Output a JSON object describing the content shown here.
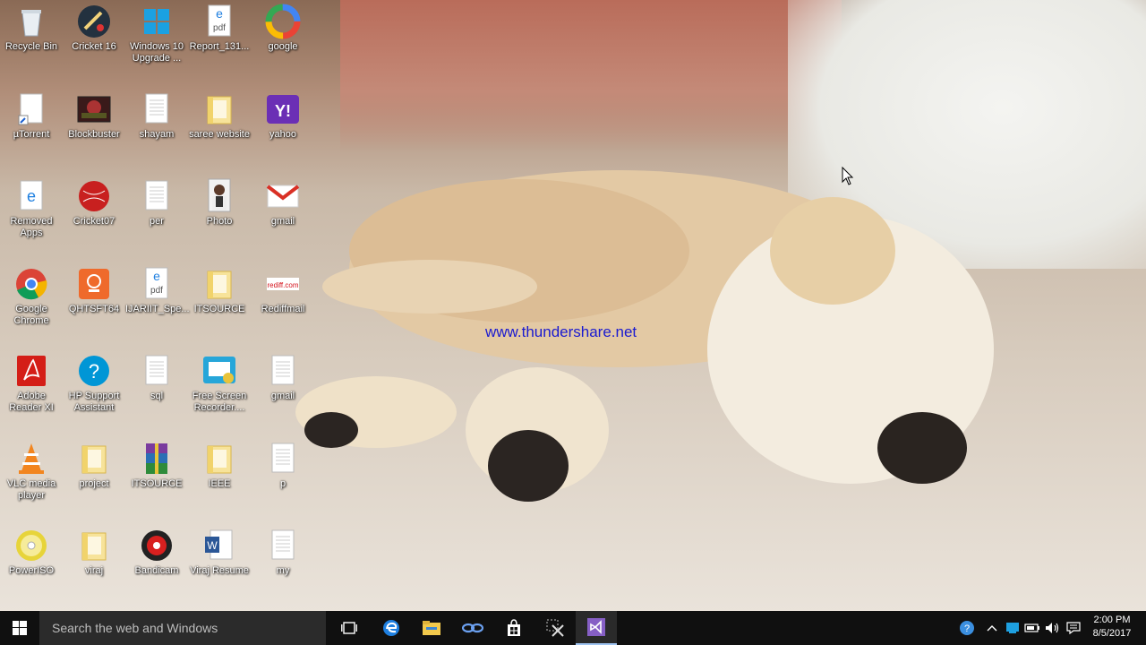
{
  "watermark": "www.thundershare.net",
  "desktop_icons": [
    {
      "label": "Recycle Bin",
      "icon": "recycle-bin-icon"
    },
    {
      "label": "Cricket 16",
      "icon": "cricket-game-icon"
    },
    {
      "label": "Windows 10 Upgrade ...",
      "icon": "windows-logo-icon"
    },
    {
      "label": "Report_131...",
      "icon": "pdf-edge-icon"
    },
    {
      "label": "google",
      "icon": "google-icon"
    },
    {
      "label": "µTorrent",
      "icon": "document-shortcut-icon"
    },
    {
      "label": "Blockbuster",
      "icon": "movie-thumbnail-icon"
    },
    {
      "label": "shayam",
      "icon": "text-document-icon"
    },
    {
      "label": "saree website",
      "icon": "folder-icon"
    },
    {
      "label": "yahoo",
      "icon": "yahoo-icon"
    },
    {
      "label": "Removed Apps",
      "icon": "edge-html-icon"
    },
    {
      "label": "Cricket07",
      "icon": "cricket-ball-icon"
    },
    {
      "label": "per",
      "icon": "text-document-icon"
    },
    {
      "label": "Photo",
      "icon": "photo-portrait-icon"
    },
    {
      "label": "gmail",
      "icon": "gmail-icon"
    },
    {
      "label": "Google Chrome",
      "icon": "chrome-icon"
    },
    {
      "label": "QHTSFT64",
      "icon": "qhtsft-app-icon"
    },
    {
      "label": "IJARIIT_Spe...",
      "icon": "pdf-edge-icon"
    },
    {
      "label": "ITSOURCE",
      "icon": "folder-icon"
    },
    {
      "label": "Rediffmail",
      "icon": "rediffmail-icon"
    },
    {
      "label": "Adobe Reader XI",
      "icon": "adobe-reader-icon"
    },
    {
      "label": "HP Support Assistant",
      "icon": "hp-support-icon"
    },
    {
      "label": "sql",
      "icon": "text-document-icon"
    },
    {
      "label": "Free Screen Recorder....",
      "icon": "screen-recorder-icon"
    },
    {
      "label": "gmail",
      "icon": "text-document-icon"
    },
    {
      "label": "VLC media player",
      "icon": "vlc-icon"
    },
    {
      "label": "project",
      "icon": "folder-icon"
    },
    {
      "label": "ITSOURCE",
      "icon": "winrar-icon"
    },
    {
      "label": "IEEE",
      "icon": "folder-icon"
    },
    {
      "label": "p",
      "icon": "text-document-icon"
    },
    {
      "label": "PowerISO",
      "icon": "poweriso-icon"
    },
    {
      "label": "viraj",
      "icon": "folder-icon"
    },
    {
      "label": "Bandicam",
      "icon": "bandicam-icon"
    },
    {
      "label": "Viraj Resume",
      "icon": "word-document-icon"
    },
    {
      "label": "my",
      "icon": "text-document-icon"
    }
  ],
  "taskbar": {
    "search_placeholder": "Search the web and Windows",
    "pinned": [
      {
        "name": "task-view-icon"
      },
      {
        "name": "edge-icon"
      },
      {
        "name": "file-explorer-icon"
      },
      {
        "name": "media-app-icon"
      },
      {
        "name": "store-icon"
      },
      {
        "name": "snipping-tool-icon"
      },
      {
        "name": "visual-studio-icon"
      }
    ],
    "clock": {
      "time": "2:00 PM",
      "date": "8/5/2017"
    }
  },
  "colors": {
    "taskbar": "#101010",
    "search_box": "#2b2b2b",
    "watermark": "#1a1ad0",
    "accent": "#9ec3f0"
  }
}
